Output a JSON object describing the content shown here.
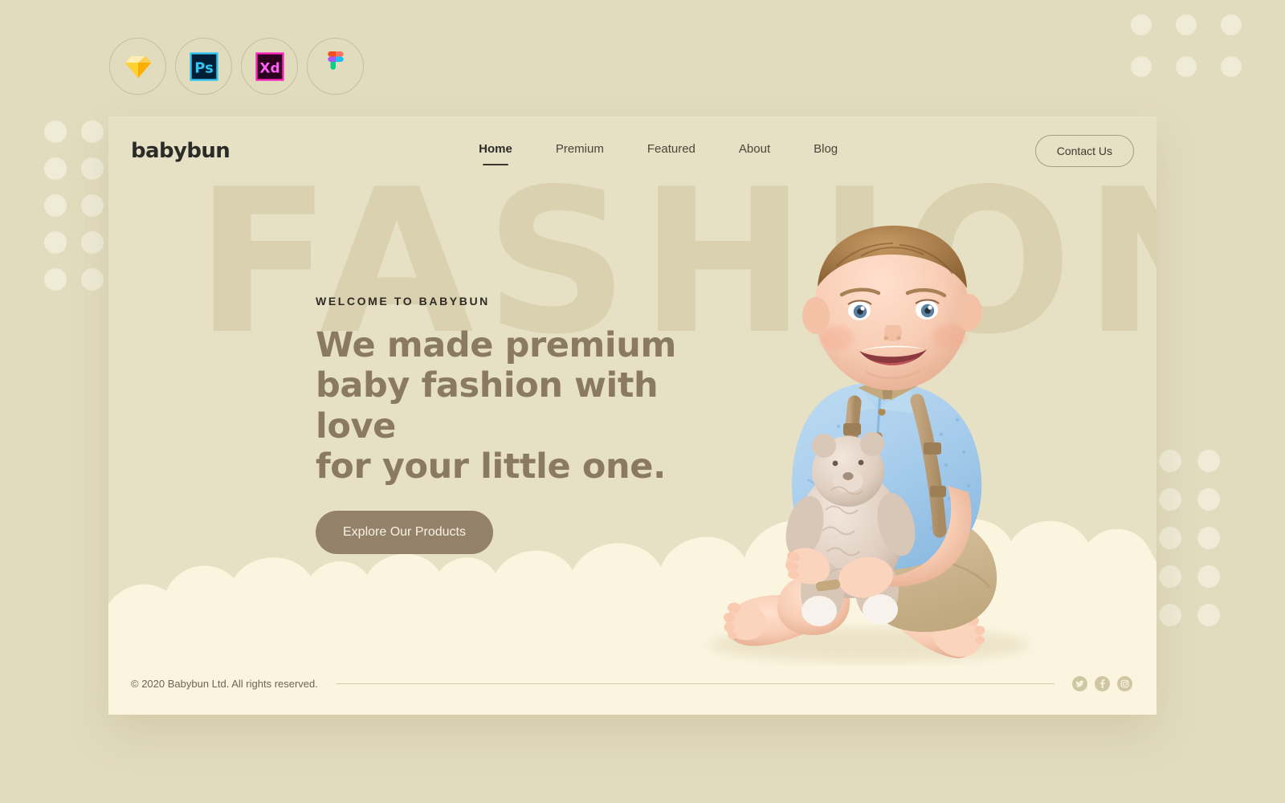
{
  "theme": {
    "page_bg": "#E2DCBE",
    "card_bg": "#E6E0C4",
    "cloud": "#FBF5E0",
    "accent_brown": "#93816A",
    "heading_brown": "#8B7A62",
    "dot": "#EFEBD6",
    "dark_text": "#2B2B28"
  },
  "toolbar": {
    "items": [
      {
        "name": "sketch",
        "label": "Sketch"
      },
      {
        "name": "photoshop",
        "label": "Ps"
      },
      {
        "name": "adobe-xd",
        "label": "Xd"
      },
      {
        "name": "figma",
        "label": "Figma"
      }
    ]
  },
  "navbar": {
    "logo": "babybun",
    "menu": [
      {
        "label": "Home",
        "active": true
      },
      {
        "label": "Premium",
        "active": false
      },
      {
        "label": "Featured",
        "active": false
      },
      {
        "label": "About",
        "active": false
      },
      {
        "label": "Blog",
        "active": false
      }
    ],
    "contact_label": "Contact Us"
  },
  "hero": {
    "watermark": "FASHION",
    "eyebrow": "WELCOME TO BABYBUN",
    "headline_line1": "We made premium",
    "headline_line2": "baby fashion with love",
    "headline_line3": "for your little one.",
    "cta_label": "Explore Our Products",
    "photo_alt": "smiling baby in blue polo shirt with suspenders holding a teddy bear"
  },
  "footer": {
    "copyright": "© 2020 Babybun Ltd. All rights reserved.",
    "socials": [
      {
        "name": "twitter-icon"
      },
      {
        "name": "facebook-icon"
      },
      {
        "name": "instagram-icon"
      }
    ]
  }
}
